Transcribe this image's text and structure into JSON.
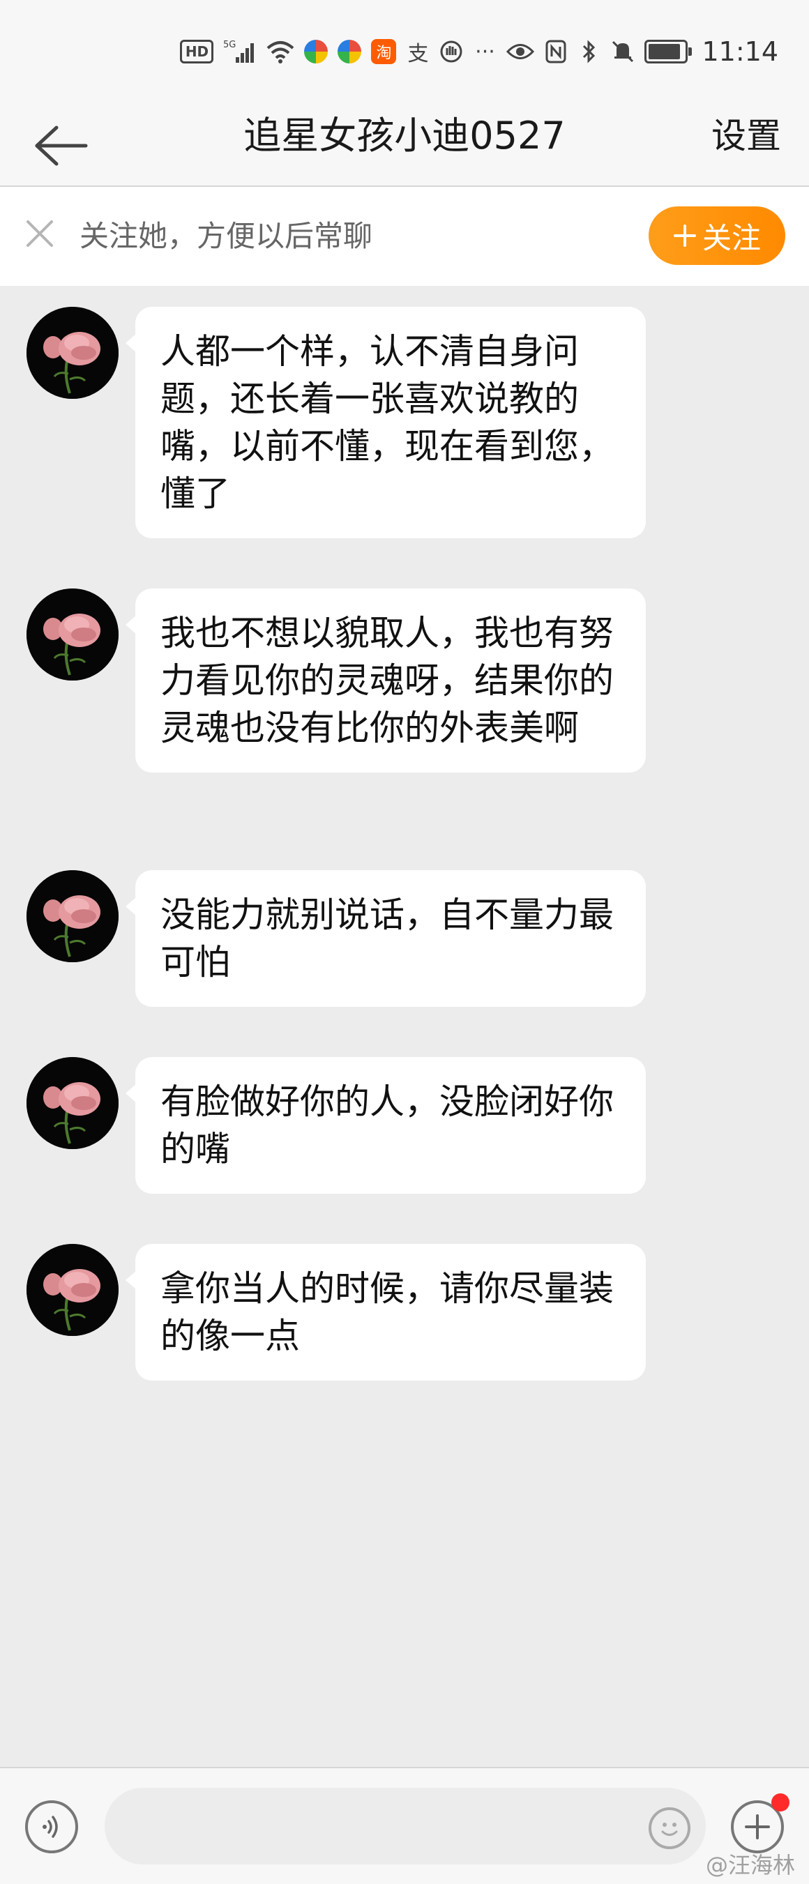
{
  "status_bar": {
    "hd": "HD",
    "network": "5G",
    "time": "11:14",
    "icons": [
      "hd-icon",
      "signal-icon",
      "wifi-icon",
      "app-circle-icon",
      "app-circle-icon",
      "taobao-icon",
      "alipay-icon",
      "hand-icon",
      "more-dots-icon",
      "eye-icon",
      "nfc-icon",
      "bluetooth-icon",
      "mute-icon",
      "battery-icon"
    ]
  },
  "header": {
    "title": "追星女孩小迪0527",
    "settings_label": "设置"
  },
  "follow_banner": {
    "text": "关注她，方便以后常聊",
    "button_label": "关注"
  },
  "messages": [
    {
      "text": "人都一个样，认不清自身问题，还长着一张喜欢说教的嘴，以前不懂，现在看到您，懂了"
    },
    {
      "text": "我也不想以貌取人，我也有努力看见你的灵魂呀，结果你的灵魂也没有比你的外表美啊"
    },
    {
      "text": "没能力就别说话，自不量力最可怕"
    },
    {
      "text": "有脸做好你的人，没脸闭好你的嘴"
    },
    {
      "text": "拿你当人的时候，请你尽量装的像一点"
    }
  ],
  "input_bar": {
    "placeholder": ""
  },
  "watermark": "@汪海林",
  "colors": {
    "accent": "#ff8a00",
    "background": "#ececec",
    "bubble": "#ffffff",
    "notification_dot": "#ff2a2a"
  }
}
